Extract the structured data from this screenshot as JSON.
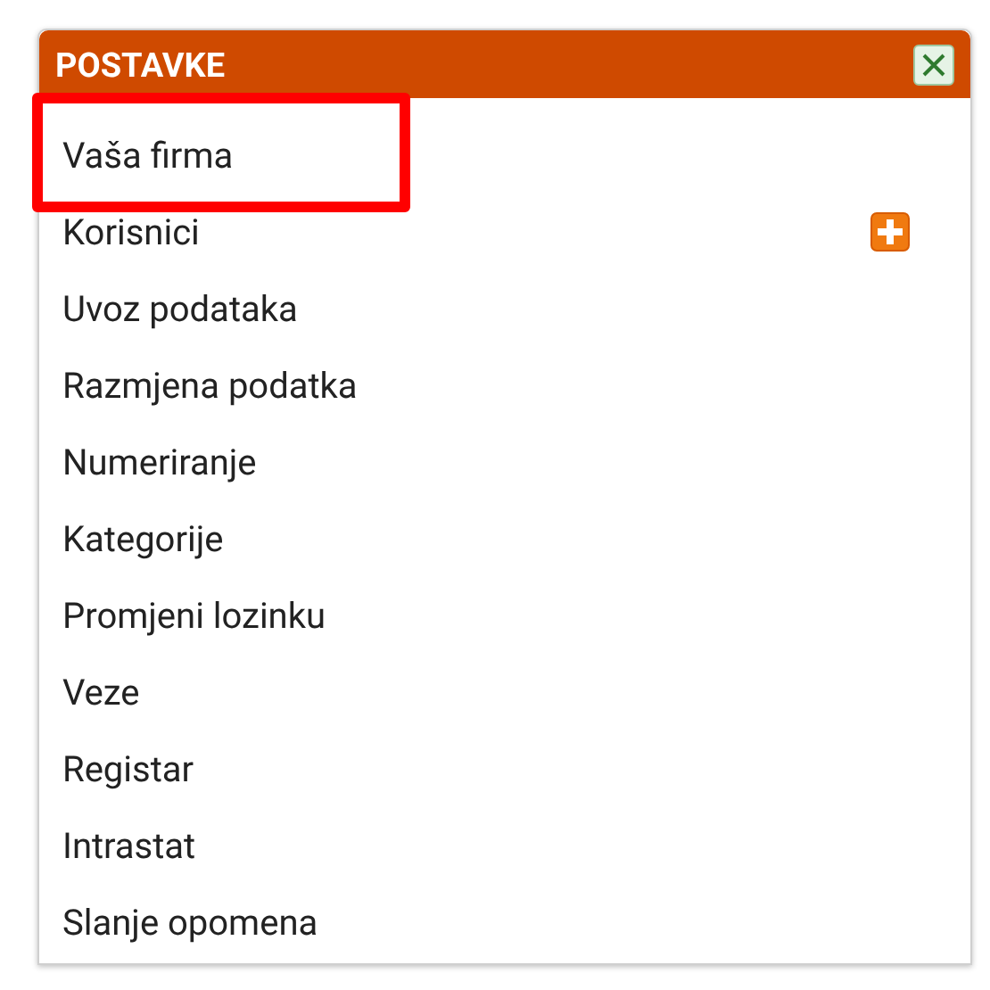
{
  "panel": {
    "title": "POSTAVKE"
  },
  "items": [
    {
      "label": "Vaša firma",
      "highlighted": true,
      "has_add": false
    },
    {
      "label": "Korisnici",
      "highlighted": false,
      "has_add": true
    },
    {
      "label": "Uvoz podataka",
      "highlighted": false,
      "has_add": false
    },
    {
      "label": "Razmjena podatka",
      "highlighted": false,
      "has_add": false
    },
    {
      "label": "Numeriranje",
      "highlighted": false,
      "has_add": false
    },
    {
      "label": "Kategorije",
      "highlighted": false,
      "has_add": false
    },
    {
      "label": "Promjeni lozinku",
      "highlighted": false,
      "has_add": false
    },
    {
      "label": "Veze",
      "highlighted": false,
      "has_add": false
    },
    {
      "label": "Registar",
      "highlighted": false,
      "has_add": false
    },
    {
      "label": "Intrastat",
      "highlighted": false,
      "has_add": false
    },
    {
      "label": "Slanje opomena",
      "highlighted": false,
      "has_add": false
    }
  ]
}
